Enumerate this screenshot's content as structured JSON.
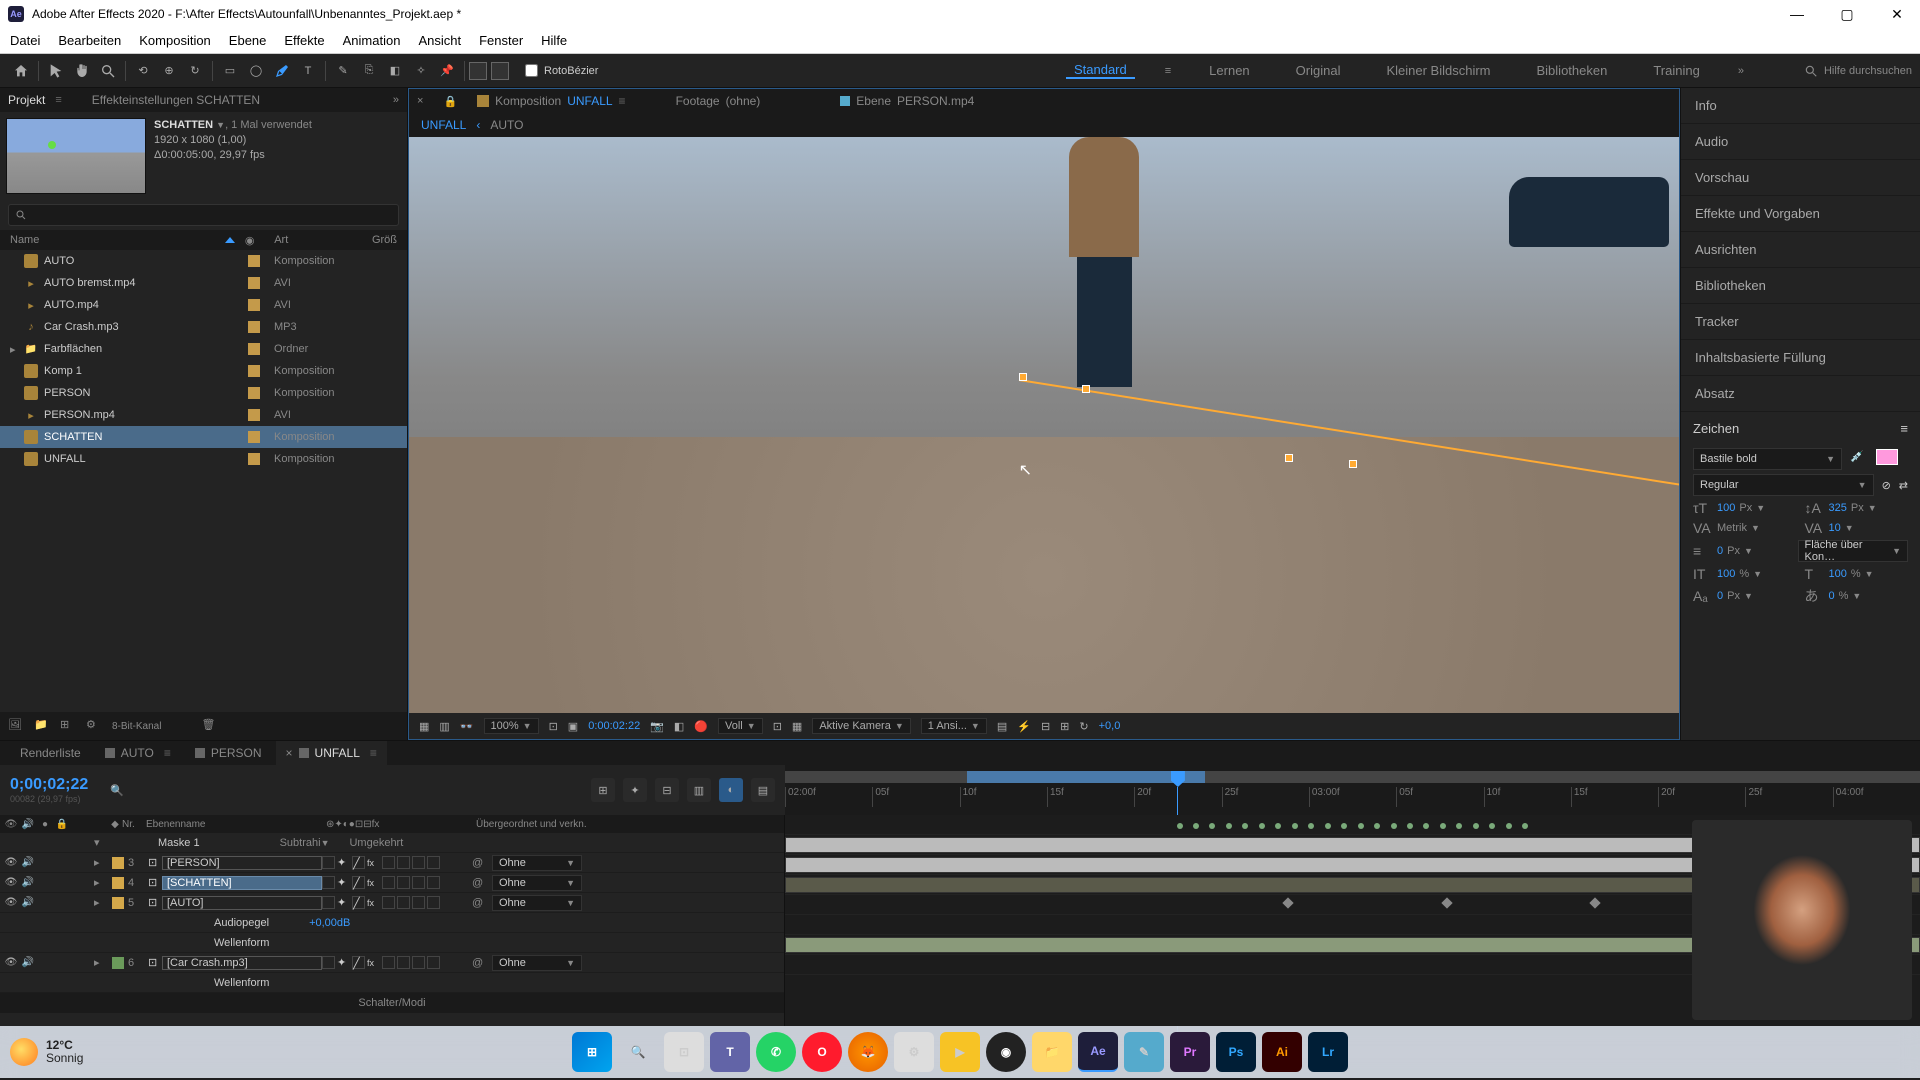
{
  "title": "Adobe After Effects 2020 - F:\\After Effects\\Autounfall\\Unbenanntes_Projekt.aep *",
  "menu": [
    "Datei",
    "Bearbeiten",
    "Komposition",
    "Ebene",
    "Effekte",
    "Animation",
    "Ansicht",
    "Fenster",
    "Hilfe"
  ],
  "toolbar": {
    "rotobezier": "RotoBézier",
    "workspaces": [
      "Standard",
      "Lernen",
      "Original",
      "Kleiner Bildschirm",
      "Bibliotheken",
      "Training"
    ],
    "active_workspace": "Standard",
    "search_help": "Hilfe durchsuchen"
  },
  "project": {
    "tab_project": "Projekt",
    "tab_effects": "Effekteinstellungen SCHATTEN",
    "selected_name": "SCHATTEN",
    "usage": ", 1 Mal verwendet",
    "dims": "1920 x 1080 (1,00)",
    "duration": "Δ0:00:05:00, 29,97 fps",
    "cols": {
      "name": "Name",
      "art": "Art",
      "size": "Größ"
    },
    "items": [
      {
        "name": "AUTO",
        "icon": "comp",
        "type": "Komposition"
      },
      {
        "name": "AUTO bremst.mp4",
        "icon": "vid",
        "type": "AVI"
      },
      {
        "name": "AUTO.mp4",
        "icon": "vid",
        "type": "AVI"
      },
      {
        "name": "Car Crash.mp3",
        "icon": "aud",
        "type": "MP3"
      },
      {
        "name": "Farbflächen",
        "icon": "folder",
        "type": "Ordner"
      },
      {
        "name": "Komp 1",
        "icon": "comp",
        "type": "Komposition"
      },
      {
        "name": "PERSON",
        "icon": "comp",
        "type": "Komposition"
      },
      {
        "name": "PERSON.mp4",
        "icon": "vid",
        "type": "AVI"
      },
      {
        "name": "SCHATTEN",
        "icon": "comp",
        "type": "Komposition",
        "selected": true
      },
      {
        "name": "UNFALL",
        "icon": "comp",
        "type": "Komposition"
      }
    ],
    "footer_bits": "8-Bit-Kanal"
  },
  "viewer": {
    "tabs": [
      {
        "prefix": "Komposition",
        "name": "UNFALL",
        "active": true
      },
      {
        "prefix": "Footage",
        "name": "(ohne)"
      },
      {
        "prefix": "Ebene",
        "name": "PERSON.mp4"
      }
    ],
    "breadcrumb": [
      "UNFALL",
      "AUTO"
    ],
    "footer": {
      "zoom": "100%",
      "timecode": "0:00:02:22",
      "res": "Voll",
      "camera": "Aktive Kamera",
      "views": "1 Ansi...",
      "exposure": "+0,0"
    }
  },
  "right_panels": [
    "Info",
    "Audio",
    "Vorschau",
    "Effekte und Vorgaben",
    "Ausrichten",
    "Bibliotheken",
    "Tracker",
    "Inhaltsbasierte Füllung",
    "Absatz"
  ],
  "char": {
    "title": "Zeichen",
    "font": "Bastile bold",
    "style": "Regular",
    "size": "100",
    "leading": "325",
    "kerning": "Metrik",
    "tracking": "10",
    "stroke": "0",
    "stroke_over": "Fläche über Kon…",
    "vscale": "100",
    "hscale": "100",
    "baseline": "0",
    "tsume": "0",
    "px": "Px",
    "pct": "%"
  },
  "timeline": {
    "tabs": [
      "Renderliste",
      "AUTO",
      "PERSON",
      "UNFALL"
    ],
    "active_tab": "UNFALL",
    "timecode": "0;00;02;22",
    "timecode_sub": "00082 (29,97 fps)",
    "ruler": [
      "02:00f",
      "05f",
      "10f",
      "15f",
      "20f",
      "25f",
      "03:00f",
      "05f",
      "10f",
      "15f",
      "20f",
      "25f",
      "04:00f"
    ],
    "col_nr": "Nr.",
    "col_name": "Ebenenname",
    "col_parent": "Übergeordnet und verkn.",
    "parent_none": "Ohne",
    "sub_label": "Subtrahi",
    "inv_label": "Umgekehrt",
    "layers": [
      {
        "nr": "",
        "name": "Maske 1",
        "indent": true,
        "color": "none"
      },
      {
        "nr": "3",
        "name": "[PERSON]",
        "boxed": true,
        "color": "yellow",
        "parent": "Ohne"
      },
      {
        "nr": "4",
        "name": "[SCHATTEN]",
        "selected": true,
        "color": "yellow",
        "parent": "Ohne"
      },
      {
        "nr": "5",
        "name": "[AUTO]",
        "boxed": true,
        "color": "yellow",
        "parent": "Ohne"
      },
      {
        "nr": "",
        "name": "Audiopegel",
        "sub": true,
        "value": "+0,00dB"
      },
      {
        "nr": "",
        "name": "Wellenform",
        "sub": true
      },
      {
        "nr": "6",
        "name": "[Car Crash.mp3]",
        "boxed": true,
        "color": "green",
        "parent": "Ohne"
      },
      {
        "nr": "",
        "name": "Wellenform",
        "sub": true
      }
    ],
    "footer": "Schalter/Modi"
  },
  "taskbar": {
    "temp": "12°C",
    "cond": "Sonnig"
  }
}
